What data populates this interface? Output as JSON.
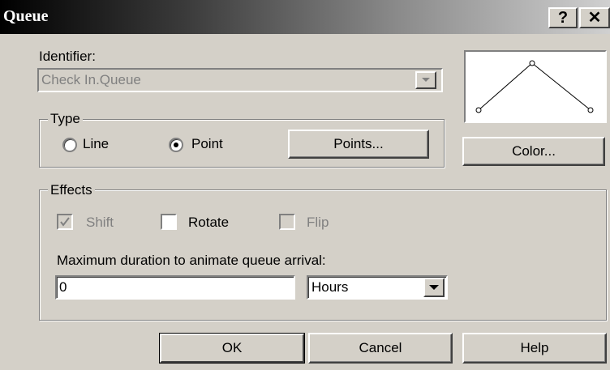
{
  "window": {
    "title": "Queue",
    "help_label": "?",
    "close_label": "✕"
  },
  "identifier": {
    "label": "Identifier:",
    "value": "Check In.Queue"
  },
  "type_group": {
    "label": "Type",
    "options": [
      {
        "label": "Line",
        "selected": false
      },
      {
        "label": "Point",
        "selected": true
      }
    ],
    "points_button": "Points..."
  },
  "color_button": "Color...",
  "effects_group": {
    "label": "Effects",
    "shift": {
      "label": "Shift",
      "checked": true,
      "enabled": false
    },
    "rotate": {
      "label": "Rotate",
      "checked": false,
      "enabled": true
    },
    "flip": {
      "label": "Flip",
      "checked": false,
      "enabled": false
    },
    "duration_label": "Maximum duration to animate queue arrival:",
    "duration_value": "0",
    "duration_unit": "Hours"
  },
  "footer": {
    "ok": "OK",
    "cancel": "Cancel",
    "help": "Help"
  },
  "icons": {
    "chevron": "chevron-down-icon",
    "check": "checkmark-icon"
  }
}
